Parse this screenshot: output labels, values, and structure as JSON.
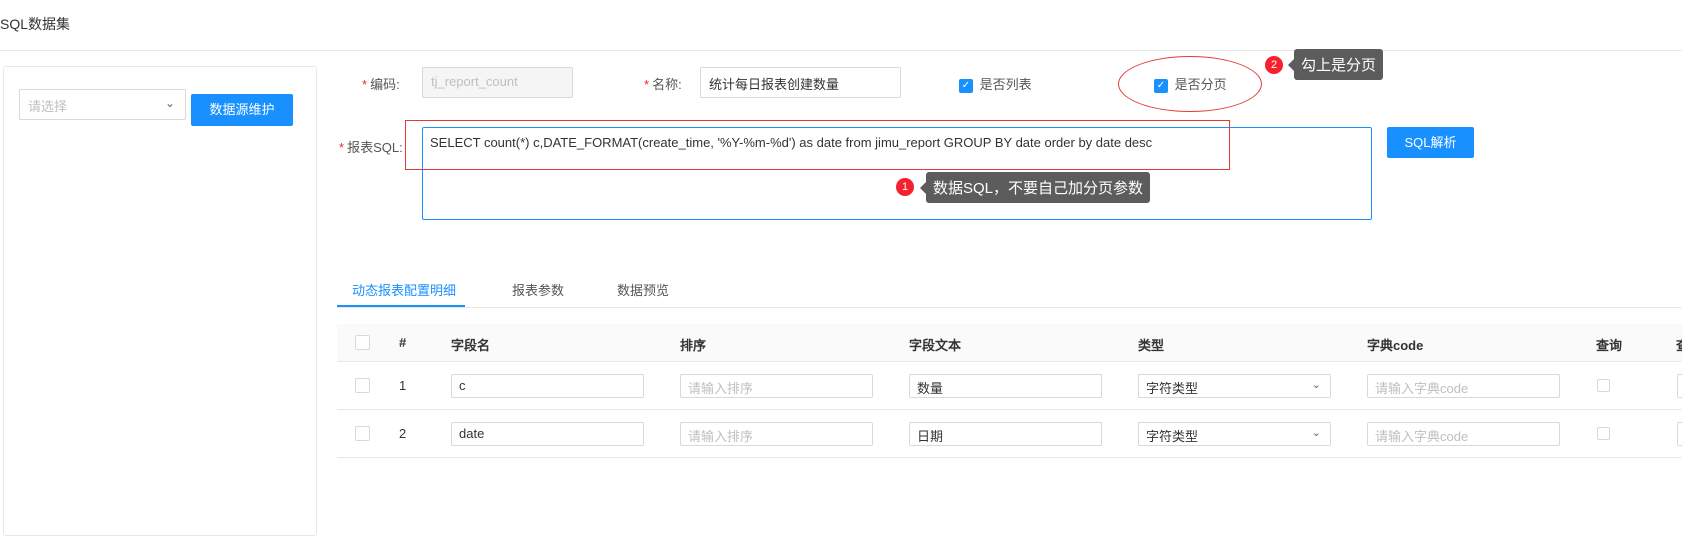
{
  "header": {
    "title": "SQL数据集"
  },
  "left": {
    "select_placeholder": "请选择",
    "maintain_button": "数据源维护"
  },
  "form": {
    "code_label": "编码:",
    "code_value": "tj_report_count",
    "name_label": "名称:",
    "name_value": "统计每日报表创建数量",
    "is_list_label": "是否列表",
    "is_page_label": "是否分页",
    "sql_label": "报表SQL:",
    "sql_value": "SELECT count(*) c,DATE_FORMAT(create_time, '%Y-%m-%d') as date  from jimu_report GROUP BY date order by date desc",
    "sql_parse_button": "SQL解析"
  },
  "annotations": {
    "badge_1": "1",
    "tip_1": "数据SQL，不要自己加分页参数",
    "badge_2": "2",
    "tip_2": "勾上是分页"
  },
  "tabs": [
    {
      "label": "动态报表配置明细",
      "active": true
    },
    {
      "label": "报表参数",
      "active": false
    },
    {
      "label": "数据预览",
      "active": false
    }
  ],
  "table": {
    "headers": [
      "#",
      "字段名",
      "排序",
      "字段文本",
      "类型",
      "字典code",
      "查询",
      "查"
    ],
    "rows": [
      {
        "index": "1",
        "field": "c",
        "order_placeholder": "请输入排序",
        "text": "数量",
        "type": "字符类型",
        "dict_placeholder": "请输入字典code"
      },
      {
        "index": "2",
        "field": "date",
        "order_placeholder": "请输入排序",
        "text": "日期",
        "type": "字符类型",
        "dict_placeholder": "请输入字典code"
      }
    ]
  },
  "colors": {
    "primary": "#1890ff",
    "annotation_red": "#e53935",
    "tooltip_bg": "#5c5c5c"
  },
  "icons": [
    "chevron-down-icon",
    "checkbox-checked-icon",
    "checkbox-empty-icon"
  ]
}
